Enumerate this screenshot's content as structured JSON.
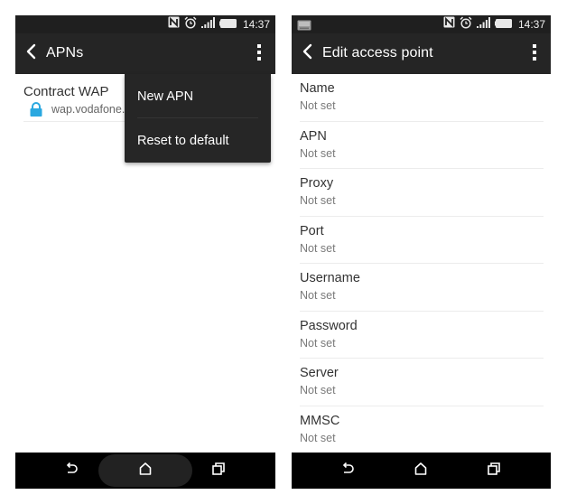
{
  "status_bar": {
    "time": "14:37",
    "icons": [
      "nfc-icon",
      "alarm-icon",
      "signal-icon",
      "battery-icon"
    ]
  },
  "left_screen": {
    "toolbar": {
      "title": "APNs",
      "back_icon": "chevron-left-icon",
      "overflow_icon": "more-vert-icon"
    },
    "apn_list": [
      {
        "name": "Contract WAP",
        "apn": "wap.vodafone.co.uk",
        "icon": "lock-icon"
      }
    ],
    "overflow_menu": {
      "items": [
        {
          "label": "New APN"
        },
        {
          "label": "Reset to default"
        }
      ]
    },
    "nav_bar": {
      "back_icon": "back-icon",
      "home_icon": "home-icon",
      "recents_icon": "recents-icon"
    }
  },
  "right_screen": {
    "status_left_icon": "keyboard-icon",
    "toolbar": {
      "title": "Edit access point",
      "back_icon": "chevron-left-icon",
      "overflow_icon": "more-vert-icon"
    },
    "fields": [
      {
        "label": "Name",
        "value": "Not set"
      },
      {
        "label": "APN",
        "value": "Not set"
      },
      {
        "label": "Proxy",
        "value": "Not set"
      },
      {
        "label": "Port",
        "value": "Not set"
      },
      {
        "label": "Username",
        "value": "Not set"
      },
      {
        "label": "Password",
        "value": "Not set"
      },
      {
        "label": "Server",
        "value": "Not set"
      },
      {
        "label": "MMSC",
        "value": "Not set"
      }
    ],
    "nav_bar": {
      "back_icon": "back-icon",
      "home_icon": "home-icon",
      "recents_icon": "recents-icon"
    }
  },
  "colors": {
    "toolbar": "#252525",
    "status_bar": "#1f1f1f",
    "lock_icon": "#2aa8e0",
    "popup": "#262626",
    "nav_bar": "#000000"
  }
}
